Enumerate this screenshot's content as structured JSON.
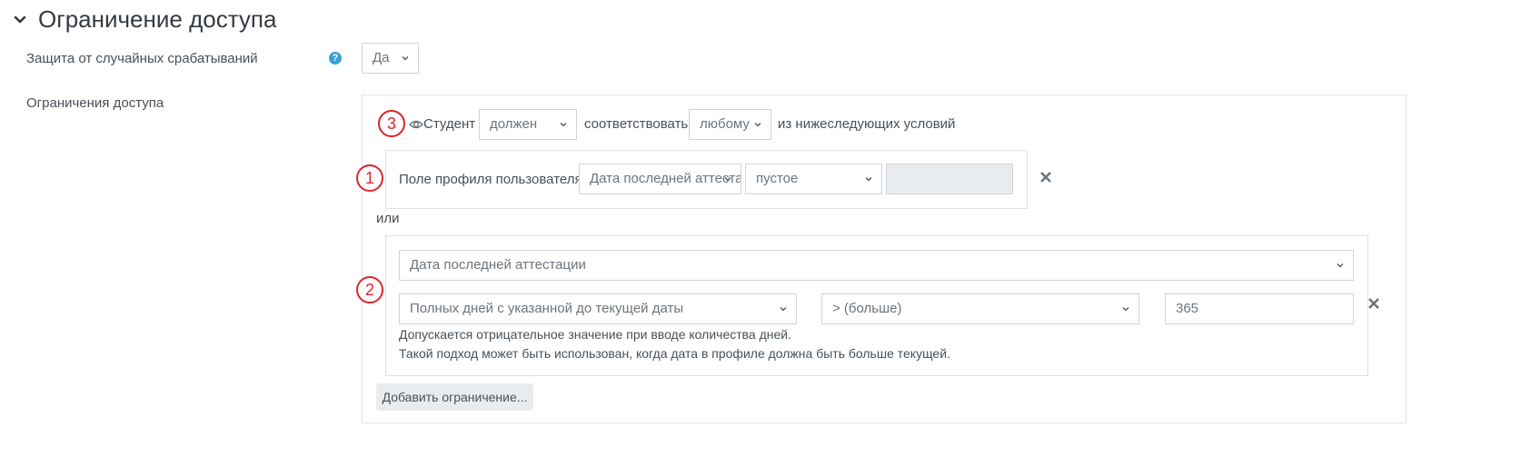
{
  "section": {
    "title": "Ограничение доступа",
    "chevron_icon": "chevron-down-icon"
  },
  "fields": {
    "protection_label": "Защита от случайных срабатываний",
    "protection_value": "Да",
    "restrictions_label": "Ограничения доступа"
  },
  "condition_header": {
    "student_label": "Студент",
    "must_value": "должен",
    "match_label": "соответствовать",
    "any_value": "любому",
    "following_label": "из нижеследующих условий"
  },
  "markers": [
    "1",
    "2",
    "3"
  ],
  "condition1": {
    "label": "Поле профиля пользователя",
    "field_value": "Дата последней аттестации",
    "operator_value": "пустое",
    "value": ""
  },
  "or_label": "или",
  "condition2": {
    "field_value": "Дата последней аттестации",
    "mode_value": "Полных дней с указанной до текущей даты",
    "operator_value": "> (больше)",
    "days_value": "365",
    "hint_line1": "Допускается отрицательное значение при вводе количества дней.",
    "hint_line2": "Такой подход может быть использован, когда дата в профиле должна быть больше текущей."
  },
  "add_button_label": "Добавить ограничение...",
  "colors": {
    "marker": "#d9262d",
    "help": "#37a0d7",
    "border": "#dee2e6",
    "button": "#e9ecef"
  }
}
